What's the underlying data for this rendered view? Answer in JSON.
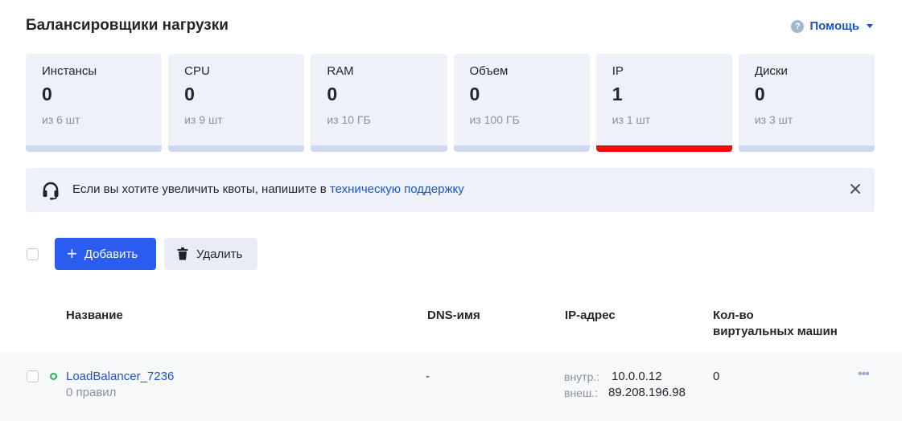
{
  "page": {
    "title": "Балансировщики нагрузки"
  },
  "help": {
    "label": "Помощь",
    "icon": "question-circle-icon"
  },
  "quotas": [
    {
      "name": "Инстансы",
      "value": "0",
      "limit": "из 6 шт",
      "usage": 0
    },
    {
      "name": "CPU",
      "value": "0",
      "limit": "из 9 шт",
      "usage": 0
    },
    {
      "name": "RAM",
      "value": "0",
      "limit": "из 10 ГБ",
      "usage": 0
    },
    {
      "name": "Объем",
      "value": "0",
      "limit": "из 100 ГБ",
      "usage": 0
    },
    {
      "name": "IP",
      "value": "1",
      "limit": "из 1 шт",
      "usage": 1
    },
    {
      "name": "Диски",
      "value": "0",
      "limit": "из 3 шт",
      "usage": 0
    }
  ],
  "colors": {
    "accent": "#2a5cf0",
    "link": "#1a56c8",
    "quota_full": "#f00d0d",
    "quota_track": "#cfdaf1",
    "status_active": "#21b35a"
  },
  "notice": {
    "text": "Если вы хотите увеличить квоты, напишите в ",
    "link": "техническую поддержку",
    "icon": "headset-icon"
  },
  "toolbar": {
    "add_label": "Добавить",
    "delete_label": "Удалить"
  },
  "table": {
    "columns": {
      "name": "Название",
      "dns": "DNS-имя",
      "ip": "IP-адрес",
      "vms_line1": "Кол-во",
      "vms_line2": "виртуальных машин"
    },
    "rows": [
      {
        "name": "LoadBalancer_7236",
        "rules": "0 правил",
        "dns": "-",
        "ip_internal_label": "внутр.:",
        "ip_internal": "10.0.0.12",
        "ip_external_label": "внеш.:",
        "ip_external": "89.208.196.98",
        "vms": "0",
        "status": "active"
      }
    ]
  }
}
